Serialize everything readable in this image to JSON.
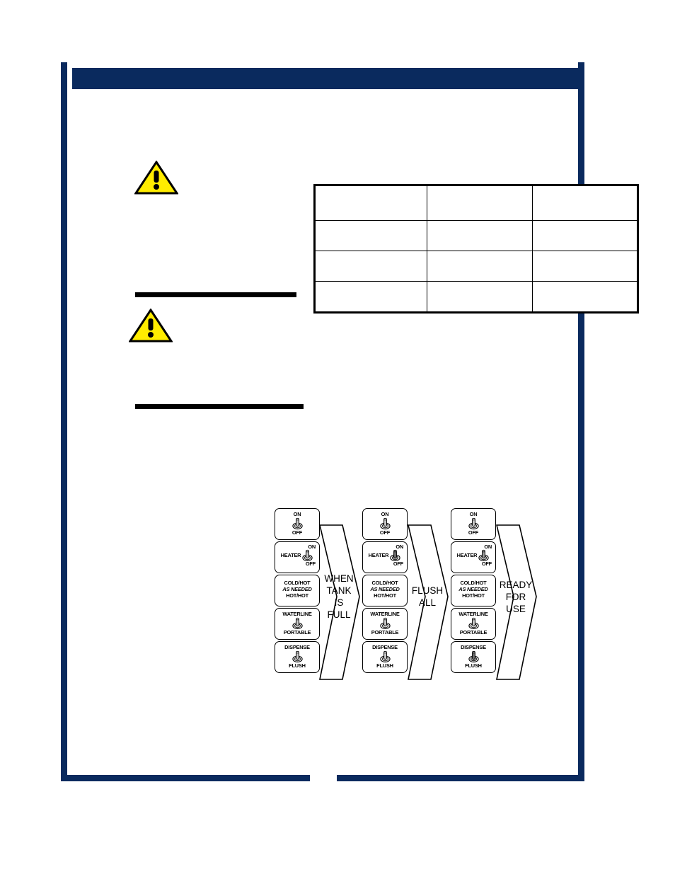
{
  "header": {
    "title": ""
  },
  "warnings": [
    {
      "icon": "warning-triangle-icon",
      "text": ""
    },
    {
      "icon": "warning-triangle-icon",
      "text": ""
    }
  ],
  "body": {
    "main_text": ""
  },
  "spec_table": {
    "rows": [
      [
        "",
        "",
        ""
      ],
      [
        "",
        "",
        ""
      ],
      [
        "",
        "",
        ""
      ],
      [
        "",
        "",
        ""
      ]
    ]
  },
  "switch_diagram": {
    "panels": [
      {
        "name": "panel-1",
        "switches": [
          {
            "id": "power",
            "top_label": "ON",
            "bottom_label": "OFF",
            "side_label": "",
            "toggle": "up",
            "style": "light"
          },
          {
            "id": "heater",
            "top_label": "ON",
            "bottom_label": "OFF",
            "side_label": "HEATER",
            "toggle": "up",
            "style": "light"
          },
          {
            "id": "temp",
            "line1": "COLD/HOT",
            "line2": "AS NEEDED",
            "line3": "HOT/HOT",
            "toggle": "none"
          },
          {
            "id": "waterline",
            "top_label": "WATERLINE",
            "bottom_label": "PORTABLE",
            "toggle": "up",
            "style": "light"
          },
          {
            "id": "dispense",
            "top_label": "DISPENSE",
            "bottom_label": "FLUSH",
            "toggle": "up",
            "style": "light"
          }
        ]
      },
      {
        "name": "panel-2",
        "switches": [
          {
            "id": "power",
            "top_label": "ON",
            "bottom_label": "OFF",
            "side_label": "",
            "toggle": "up",
            "style": "light"
          },
          {
            "id": "heater",
            "top_label": "ON",
            "bottom_label": "OFF",
            "side_label": "HEATER",
            "toggle": "up",
            "style": "dark"
          },
          {
            "id": "temp",
            "line1": "COLD/HOT",
            "line2": "AS NEEDED",
            "line3": "HOT/HOT",
            "toggle": "none"
          },
          {
            "id": "waterline",
            "top_label": "WATERLINE",
            "bottom_label": "PORTABLE",
            "toggle": "up",
            "style": "light"
          },
          {
            "id": "dispense",
            "top_label": "DISPENSE",
            "bottom_label": "FLUSH",
            "toggle": "up",
            "style": "light"
          }
        ]
      },
      {
        "name": "panel-3",
        "switches": [
          {
            "id": "power",
            "top_label": "ON",
            "bottom_label": "OFF",
            "side_label": "",
            "toggle": "up",
            "style": "light"
          },
          {
            "id": "heater",
            "top_label": "ON",
            "bottom_label": "OFF",
            "side_label": "HEATER",
            "toggle": "up",
            "style": "mid"
          },
          {
            "id": "temp",
            "line1": "COLD/HOT",
            "line2": "AS NEEDED",
            "line3": "HOT/HOT",
            "toggle": "none"
          },
          {
            "id": "waterline",
            "top_label": "WATERLINE",
            "bottom_label": "PORTABLE",
            "toggle": "up",
            "style": "light"
          },
          {
            "id": "dispense",
            "top_label": "DISPENSE",
            "bottom_label": "FLUSH",
            "toggle": "up",
            "style": "dark"
          }
        ]
      }
    ],
    "arrows": [
      {
        "name": "arrow-when-tank-is-full",
        "lines": [
          "WHEN",
          "TANK",
          "IS",
          "FULL"
        ]
      },
      {
        "name": "arrow-flush-all",
        "lines": [
          "FLUSH",
          "ALL"
        ]
      },
      {
        "name": "arrow-ready-for-use",
        "lines": [
          "READY",
          "FOR",
          "USE"
        ]
      }
    ]
  },
  "colors": {
    "navy": "#0a2a5e",
    "warning_yellow": "#ffec00",
    "black": "#000000",
    "white": "#ffffff"
  }
}
